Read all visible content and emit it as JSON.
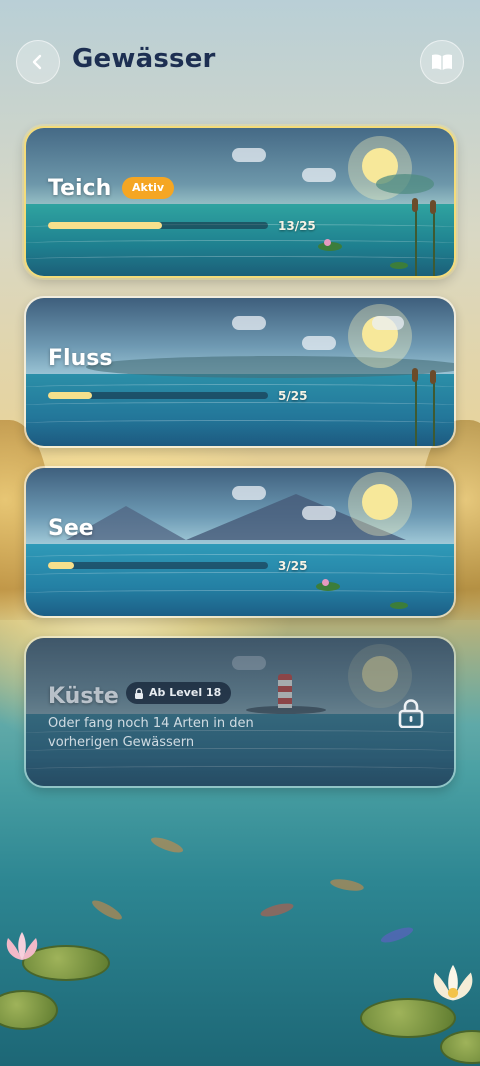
{
  "header": {
    "title": "Gewässer",
    "back_icon": "chevron-left-icon",
    "guide_icon": "book-icon"
  },
  "waters": [
    {
      "name": "Teich",
      "badge": "Aktiv",
      "progress_label": "13/25",
      "caught": 13,
      "total": 25,
      "state": "active"
    },
    {
      "name": "Fluss",
      "progress_label": "5/25",
      "caught": 5,
      "total": 25,
      "state": "unlocked"
    },
    {
      "name": "See",
      "progress_label": "3/25",
      "caught": 3,
      "total": 25,
      "state": "unlocked"
    },
    {
      "name": "Küste",
      "lock_label": "Ab Level 18",
      "hint": "Oder fang noch 14 Arten in den vorherigen Gewässern",
      "state": "locked"
    }
  ],
  "colors": {
    "title": "#1d2f52",
    "active_badge": "#f5a623",
    "active_border": "#f4dc7a",
    "progress_fill": "#f6e08c"
  }
}
